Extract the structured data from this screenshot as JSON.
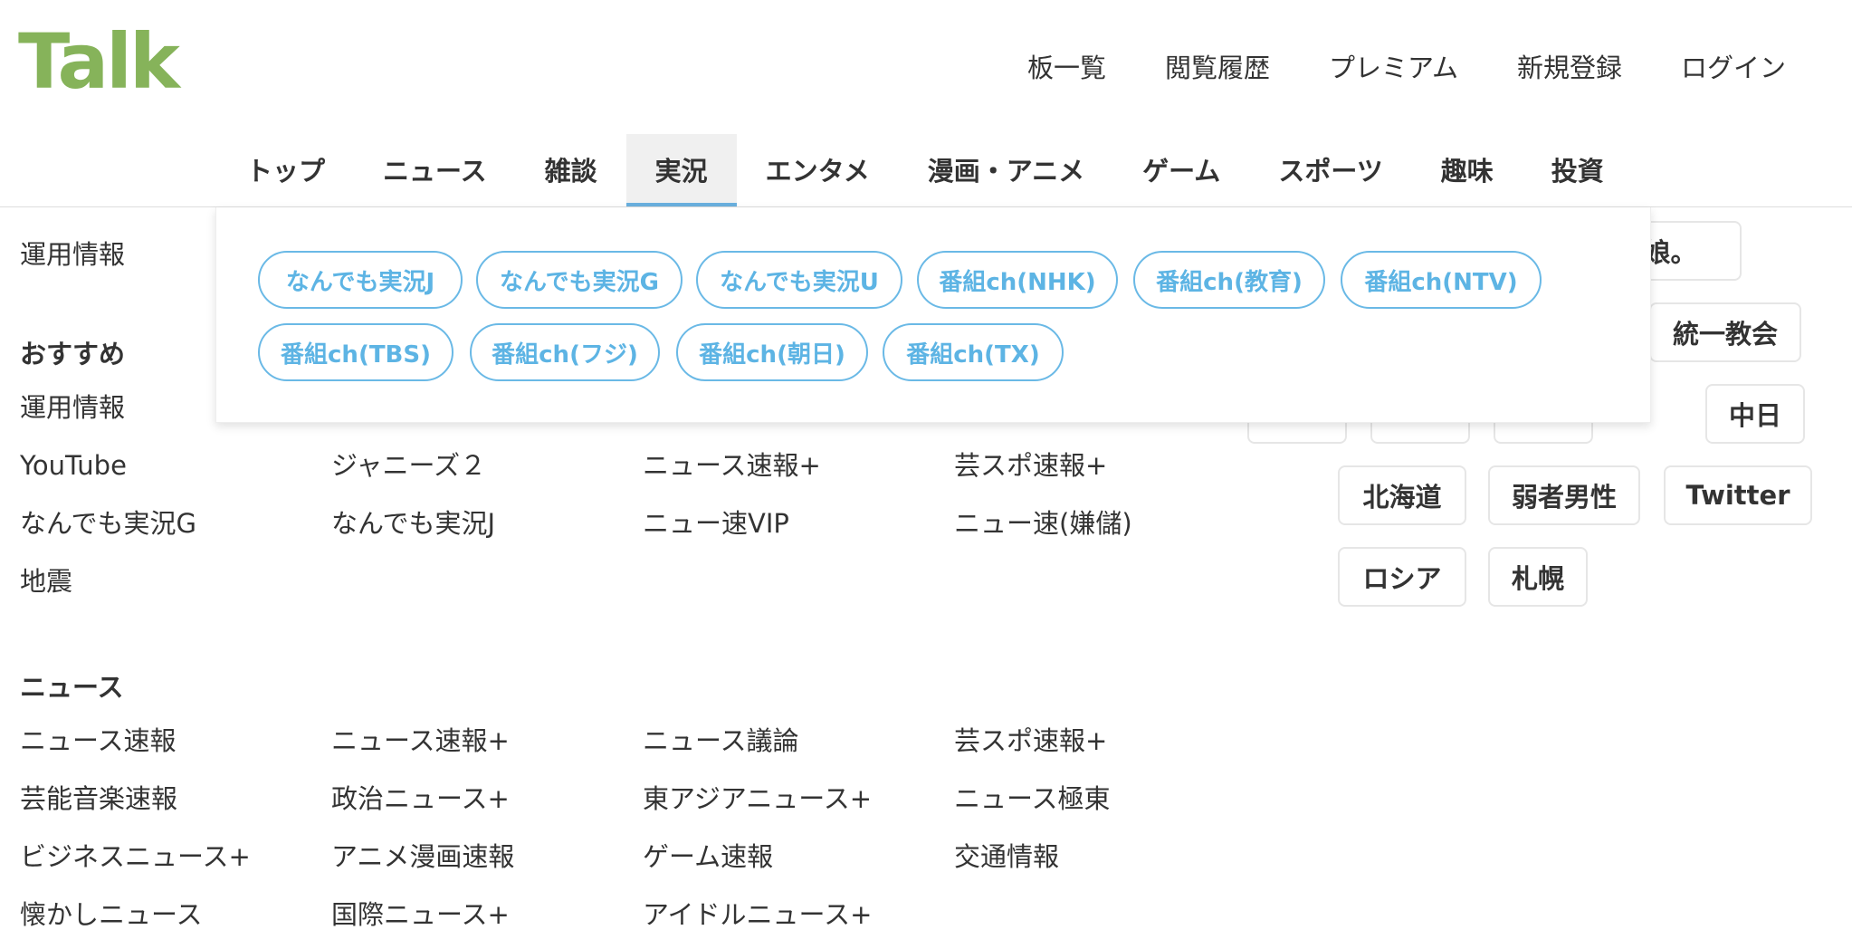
{
  "header": {
    "logo": "Talk",
    "user_nav": [
      "板一覧",
      "閲覧履歴",
      "プレミアム",
      "新規登録",
      "ログイン"
    ]
  },
  "category_nav": [
    "トップ",
    "ニュース",
    "雑談",
    "実況",
    "エンタメ",
    "漫画・アニメ",
    "ゲーム",
    "スポーツ",
    "趣味",
    "投資"
  ],
  "active_category": "実況",
  "dropdown": {
    "items": [
      "なんでも実況J",
      "なんでも実況G",
      "なんでも実況U",
      "番組ch(NHK)",
      "番組ch(教育)",
      "番組ch(NTV)",
      "番組ch(TBS)",
      "番組ch(フジ)",
      "番組ch(朝日)",
      "番組ch(TX)"
    ]
  },
  "content": {
    "top_link": "運用情報",
    "recommended": {
      "title": "おすすめ",
      "links": [
        "運用情報",
        "",
        "",
        "",
        "YouTube",
        "ジャニーズ２",
        "ニュース速報+",
        "芸スポ速報+",
        "なんでも実況G",
        "なんでも実況J",
        "ニュー速VIP",
        "ニュー速(嫌儲)",
        "地震"
      ]
    },
    "news": {
      "title": "ニュース",
      "links": [
        "ニュース速報",
        "ニュース速報+",
        "ニュース議論",
        "芸スポ速報+",
        "芸能音楽速報",
        "政治ニュース+",
        "東アジアニュース+",
        "ニュース極東",
        "ビジネスニュース+",
        "アニメ漫画速報",
        "ゲーム速報",
        "交通情報",
        "懐かしニュース",
        "国際ニュース+",
        "アイドルニュース+"
      ]
    }
  },
  "tags": [
    "グ娘。",
    "統一教会",
    "中日",
    "北海道",
    "弱者男性",
    "Twitter",
    "ロシア",
    "札幌"
  ],
  "colors": {
    "logo": "#86b35a",
    "accent": "#6ab0de",
    "pill": "#5db4e4"
  }
}
